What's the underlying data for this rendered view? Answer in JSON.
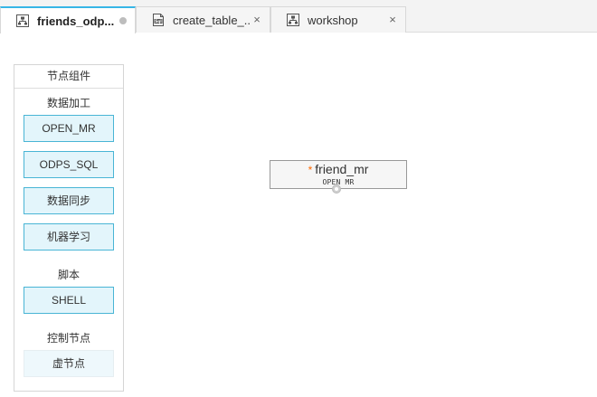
{
  "tabs": [
    {
      "label": "friends_odp...",
      "icon": "workflow-icon",
      "active": true,
      "status": "unsaved-dot"
    },
    {
      "label": "create_table_...",
      "icon": "sql-file-icon",
      "active": false,
      "close": "×"
    },
    {
      "label": "workshop",
      "icon": "workflow-icon",
      "active": false,
      "close": "×"
    }
  ],
  "panel": {
    "title": "节点组件",
    "groups": [
      {
        "title": "数据加工",
        "items": [
          "OPEN_MR",
          "ODPS_SQL",
          "数据同步",
          "机器学习"
        ]
      },
      {
        "title": "脚本",
        "items": [
          "SHELL"
        ]
      },
      {
        "title": "控制节点",
        "items": [
          "虚节点"
        ]
      }
    ]
  },
  "canvas": {
    "node": {
      "marker": "*",
      "name": "friend_mr",
      "type": "OPEN MR"
    }
  },
  "colors": {
    "accent": "#36b6e6",
    "button_border": "#49b5d5",
    "button_fill": "#e3f5fb",
    "unsaved_marker": "#ff6a00"
  }
}
